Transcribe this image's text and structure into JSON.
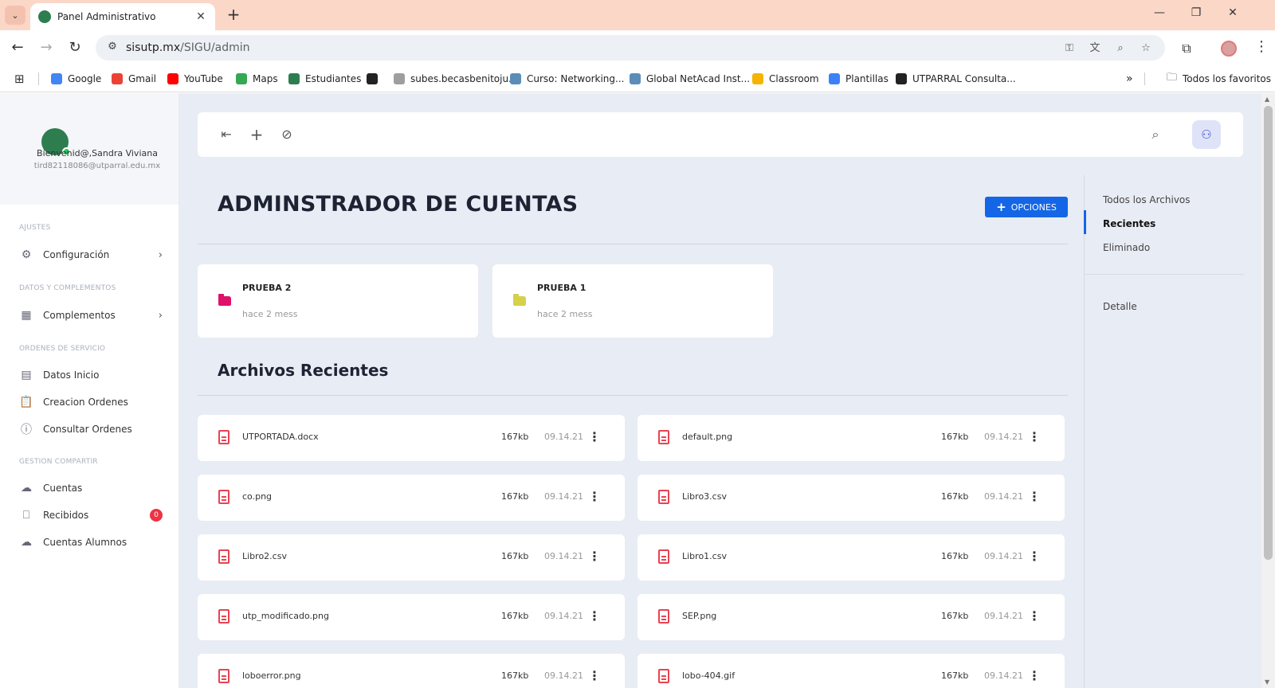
{
  "browser": {
    "tab_title": "Panel Administrativo",
    "tab_close": "✕",
    "new_tab": "+",
    "url_host": "sisutp.mx",
    "url_path": "/SIGU/admin",
    "window_controls": {
      "minimize": "—",
      "restore": "❐",
      "close": "✕"
    },
    "bookmarks": [
      {
        "label": "Google",
        "color": "#4285f4"
      },
      {
        "label": "Gmail",
        "color": "#ea4335"
      },
      {
        "label": "YouTube",
        "color": "#ff0000"
      },
      {
        "label": "Maps",
        "color": "#34a853"
      },
      {
        "label": "Estudiantes",
        "color": "#2e7d4f"
      },
      {
        "label": "",
        "color": "#222222"
      },
      {
        "label": "subes.becasbenitoju...",
        "color": "#9e9e9e"
      },
      {
        "label": "Curso: Networking...",
        "color": "#5b8db8"
      },
      {
        "label": "Global NetAcad Inst...",
        "color": "#5b8db8"
      },
      {
        "label": "Classroom",
        "color": "#f5b400"
      },
      {
        "label": "Plantillas",
        "color": "#3b82f6"
      },
      {
        "label": "UTPARRAL Consulta...",
        "color": "#222222"
      }
    ],
    "bookmarks_more": "»",
    "all_bookmarks": "Todos los favoritos"
  },
  "sidebar": {
    "welcome": "Bienvenid@,Sandra Viviana",
    "email": "tird82118086@utparral.edu.mx",
    "sections": [
      {
        "title": "AJUSTES"
      },
      {
        "title": "DATOS Y COMPLEMENTOS"
      },
      {
        "title": "ORDENES DE SERVICIO"
      },
      {
        "title": "GESTION COMPARTIR"
      }
    ],
    "items": [
      {
        "label": "Configuración",
        "icon": "gear-icon"
      },
      {
        "label": "Complementos",
        "icon": "calendar-icon"
      },
      {
        "label": "Datos Inicio",
        "icon": "chart-icon"
      },
      {
        "label": "Creacion Ordenes",
        "icon": "clipboard-icon"
      },
      {
        "label": "Consultar Ordenes",
        "icon": "info-icon"
      },
      {
        "label": "Cuentas",
        "icon": "cloud-icon"
      },
      {
        "label": "Recibidos",
        "icon": "inbox-icon",
        "badge": "0"
      },
      {
        "label": "Cuentas Alumnos",
        "icon": "cloud-icon"
      }
    ]
  },
  "main": {
    "title": "ADMINSTRADOR DE CUENTAS",
    "options_label": "OPCIONES",
    "folders": [
      {
        "name": "PRUEBA 2",
        "time": "hace 2 mess",
        "color": "#e0116b"
      },
      {
        "name": "PRUEBA 1",
        "time": "hace 2 mess",
        "color": "#d6d04a"
      }
    ],
    "recent_title": "Archivos Recientes",
    "files": [
      {
        "name": "UTPORTADA.docx",
        "size": "167kb",
        "date": "09.14.21"
      },
      {
        "name": "default.png",
        "size": "167kb",
        "date": "09.14.21"
      },
      {
        "name": "co.png",
        "size": "167kb",
        "date": "09.14.21"
      },
      {
        "name": "Libro3.csv",
        "size": "167kb",
        "date": "09.14.21"
      },
      {
        "name": "Libro2.csv",
        "size": "167kb",
        "date": "09.14.21"
      },
      {
        "name": "Libro1.csv",
        "size": "167kb",
        "date": "09.14.21"
      },
      {
        "name": "utp_modificado.png",
        "size": "167kb",
        "date": "09.14.21"
      },
      {
        "name": "SEP.png",
        "size": "167kb",
        "date": "09.14.21"
      },
      {
        "name": "loboerror.png",
        "size": "167kb",
        "date": "09.14.21"
      },
      {
        "name": "lobo-404.gif",
        "size": "167kb",
        "date": "09.14.21"
      }
    ]
  },
  "right_panel": {
    "all_files": "Todos los Archivos",
    "recent": "Recientes",
    "deleted": "Eliminado",
    "detail": "Detalle"
  },
  "colors": {
    "accent": "#1466e6",
    "page_bg": "#e8ecf5",
    "file_icon": "#e84352",
    "tabstrip": "#fbd7c8"
  }
}
